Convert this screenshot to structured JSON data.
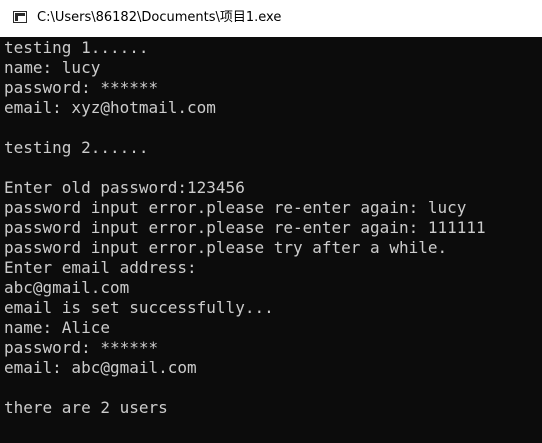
{
  "window": {
    "title": "C:\\Users\\86182\\Documents\\项目1.exe"
  },
  "console": {
    "lines": [
      "testing 1......",
      "name: lucy",
      "password: ******",
      "email: xyz@hotmail.com",
      "",
      "testing 2......",
      "",
      "Enter old password:123456",
      "password input error.please re-enter again: lucy",
      "password input error.please re-enter again: 111111",
      "password input error.please try after a while.",
      "Enter email address:",
      "abc@gmail.com",
      "email is set successfully...",
      "name: Alice",
      "password: ******",
      "email: abc@gmail.com",
      "",
      "there are 2 users"
    ]
  }
}
